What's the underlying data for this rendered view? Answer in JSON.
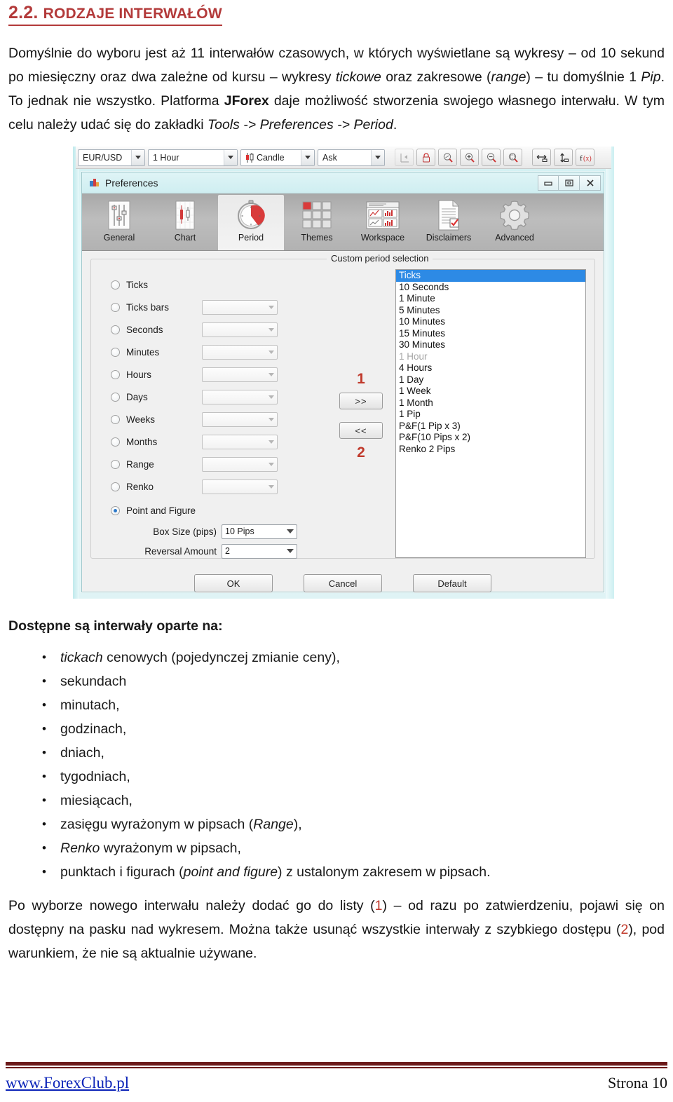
{
  "heading": {
    "number": "2.2.",
    "title": "RODZAJE INTERWAŁÓW"
  },
  "intro_paragraph": {
    "line": "Domyślnie do wyboru jest aż 11 interwałów czasowych, w których wyświetlane są wykresy – od 10 sekund po miesięczny oraz dwa zależne od kursu – wykresy tickowe oraz zakresowe (range) – tu domyślnie 1 Pip. To jednak nie wszystko. Platforma JForex daje możliwość stworzenia swojego własnego interwału. W tym celu należy udać się do zakładki Tools -> Preferences -> Period.",
    "seg1": "Domyślnie do wyboru jest aż 11 interwałów czasowych, w których wyświetlane są wykresy – od 10 sekund po miesięczny oraz dwa zależne od kursu – wykresy ",
    "seg2_italic": "tickowe",
    "seg3": " oraz zakresowe (",
    "seg4_italic": "range",
    "seg5": ") – tu domyślnie 1 ",
    "seg6_italic": "Pip",
    "seg7": ". To jednak nie wszystko. Platforma ",
    "seg8_bold": "JForex",
    "seg9": " daje możliwość stworzenia swojego własnego interwału.  W tym celu należy udać się do zakładki ",
    "seg10_italic": "Tools -> Preferences -> Period",
    "seg11": "."
  },
  "screenshot": {
    "chart_toolbar": {
      "symbol": "EUR/USD",
      "period": "1 Hour",
      "chart_type": "Candle",
      "price_side": "Ask",
      "buttons": [
        "scroll-to-start-icon",
        "lock-icon",
        "zoom-select-icon",
        "zoom-in-icon",
        "zoom-out-icon",
        "zoom-region-icon",
        "horizontal-scale-icon",
        "vertical-scale-icon",
        "function-icon"
      ]
    },
    "preferences": {
      "title": "Preferences",
      "window_buttons": [
        "minimize",
        "restore",
        "close"
      ],
      "tabs": [
        {
          "label": "General",
          "icon": "sliders-icon",
          "active": false
        },
        {
          "label": "Chart",
          "icon": "candlestick-icon",
          "active": false
        },
        {
          "label": "Period",
          "icon": "stopwatch-icon",
          "active": true
        },
        {
          "label": "Themes",
          "icon": "grid-swatch-icon",
          "active": false
        },
        {
          "label": "Workspace",
          "icon": "window-panels-icon",
          "active": false
        },
        {
          "label": "Disclaimers",
          "icon": "document-check-icon",
          "active": false
        },
        {
          "label": "Advanced",
          "icon": "gear-icon",
          "active": false
        }
      ],
      "group_legend": "Custom period selection",
      "period_options": [
        {
          "label": "Ticks",
          "selected": true,
          "has_combo": false,
          "combo_value": ""
        },
        {
          "label": "Ticks bars",
          "selected": false,
          "has_combo": true,
          "combo_value": ""
        },
        {
          "label": "Seconds",
          "selected": false,
          "has_combo": true,
          "combo_value": ""
        },
        {
          "label": "Minutes",
          "selected": false,
          "has_combo": true,
          "combo_value": ""
        },
        {
          "label": "Hours",
          "selected": false,
          "has_combo": true,
          "combo_value": ""
        },
        {
          "label": "Days",
          "selected": false,
          "has_combo": true,
          "combo_value": ""
        },
        {
          "label": "Weeks",
          "selected": false,
          "has_combo": true,
          "combo_value": ""
        },
        {
          "label": "Months",
          "selected": false,
          "has_combo": true,
          "combo_value": ""
        },
        {
          "label": "Range",
          "selected": false,
          "has_combo": true,
          "combo_value": ""
        },
        {
          "label": "Renko",
          "selected": false,
          "has_combo": true,
          "combo_value": ""
        }
      ],
      "point_and_figure": {
        "radio_label": "Point and Figure",
        "selected": true,
        "box_size_label": "Box Size (pips)",
        "box_size_value": "10 Pips",
        "reversal_label": "Reversal Amount",
        "reversal_value": "2"
      },
      "transfer_buttons": {
        "add_label": ">>",
        "remove_label": "<<",
        "annotation_top": "1",
        "annotation_bottom": "2"
      },
      "period_list": [
        {
          "label": "Ticks",
          "state": "selected"
        },
        {
          "label": "10 Seconds",
          "state": "normal"
        },
        {
          "label": "1 Minute",
          "state": "normal"
        },
        {
          "label": "5 Minutes",
          "state": "normal"
        },
        {
          "label": "10 Minutes",
          "state": "normal"
        },
        {
          "label": "15 Minutes",
          "state": "normal"
        },
        {
          "label": "30 Minutes",
          "state": "normal"
        },
        {
          "label": "1 Hour",
          "state": "dimmed"
        },
        {
          "label": "4 Hours",
          "state": "normal"
        },
        {
          "label": "1 Day",
          "state": "normal"
        },
        {
          "label": "1 Week",
          "state": "normal"
        },
        {
          "label": "1 Month",
          "state": "normal"
        },
        {
          "label": "1 Pip",
          "state": "normal"
        },
        {
          "label": "P&F(1 Pip x 3)",
          "state": "normal"
        },
        {
          "label": "P&F(10 Pips x 2)",
          "state": "normal"
        },
        {
          "label": "Renko 2 Pips",
          "state": "normal"
        }
      ],
      "dialog_buttons": [
        {
          "label": "OK"
        },
        {
          "label": "Cancel"
        },
        {
          "label": "Default"
        }
      ]
    }
  },
  "list_section": {
    "lead": "Dostępne są interwały oparte na:",
    "items": [
      {
        "italic_prefix": "tickach",
        "rest": " cenowych (pojedynczej zmianie ceny),"
      },
      {
        "italic_prefix": "",
        "rest": "sekundach"
      },
      {
        "italic_prefix": "",
        "rest": "minutach,"
      },
      {
        "italic_prefix": "",
        "rest": "godzinach,"
      },
      {
        "italic_prefix": "",
        "rest": "dniach,"
      },
      {
        "italic_prefix": "",
        "rest": "tygodniach,"
      },
      {
        "italic_prefix": "",
        "rest": "miesiącach,"
      },
      {
        "italic_prefix": "",
        "rest": "zasięgu wyrażonym w pipsach (Range),"
      },
      {
        "italic_prefix": "Renko",
        "rest": " wyrażonym w pipsach,"
      },
      {
        "italic_prefix": "",
        "rest": "punktach i figurach (point and figure) z ustalonym zakresem w pipsach."
      }
    ]
  },
  "closing_paragraph": {
    "s1": "Po wyborze nowego interwału należy dodać go do listy (",
    "m1": "1",
    "s2": ") – od razu po zatwierdzeniu, pojawi się on dostępny na pasku nad wykresem. Można także usunąć wszystkie interwały z szybkiego dostępu (",
    "m2": "2",
    "s3": "), pod warunkiem, że nie są aktualnie używane."
  },
  "footer": {
    "site": "www.ForexClub.pl",
    "page": "Strona 10"
  },
  "colors": {
    "heading_red": "#b33a3a",
    "accent_red": "#c0392b",
    "footer_bar": "#6b1a1a",
    "link_blue": "#0b23b8",
    "list_selection_blue": "#2d8ae5"
  }
}
